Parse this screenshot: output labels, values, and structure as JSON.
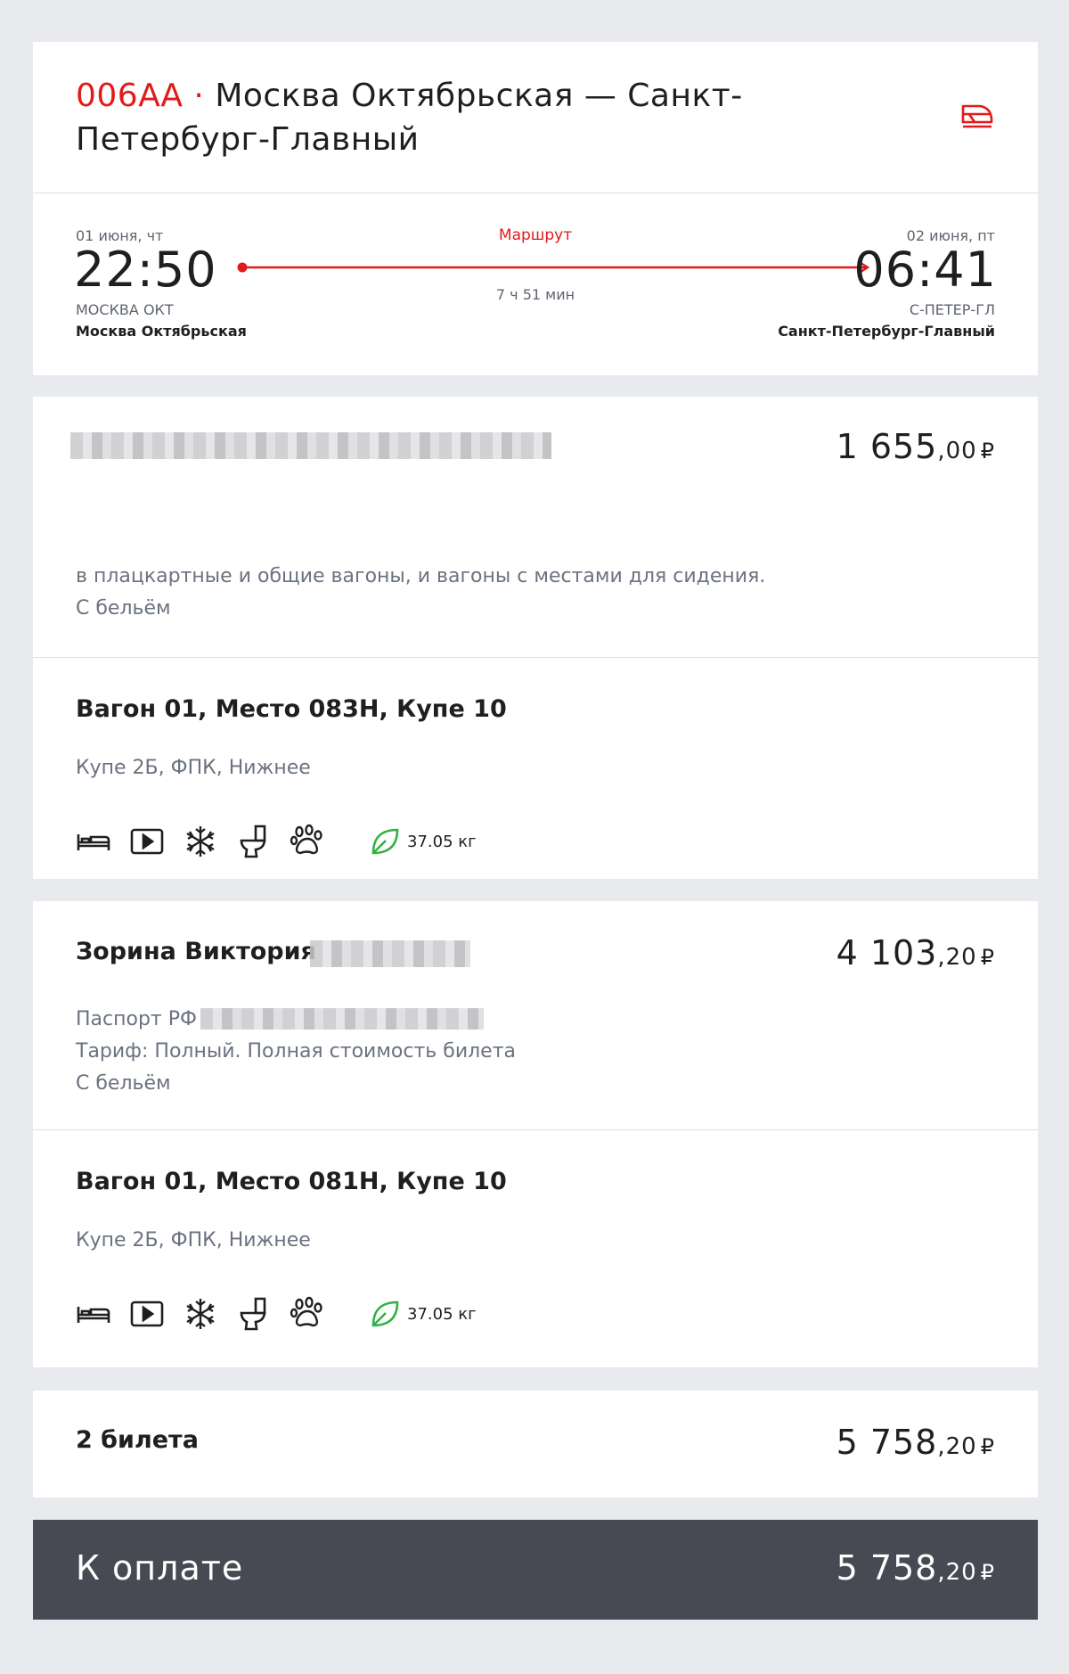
{
  "train": {
    "number": "006АА",
    "separator": "·",
    "route": "Москва Октябрьская — Санкт-Петербург-Главный",
    "brand_color": "#e21a1a",
    "logo_icon": "train-logo-icon"
  },
  "trip": {
    "departure": {
      "date": "01 июня, чт",
      "time": "22:50",
      "code": "МОСКВА ОКТ",
      "station": "Москва Октябрьская"
    },
    "route_label": "Маршрут",
    "duration": "7 ч 51 мин",
    "arrival": {
      "date": "02 июня, пт",
      "time": "06:41",
      "code": "С-ПЕТЕР-ГЛ",
      "station": "Санкт-Петербург-Главный"
    }
  },
  "passengers": [
    {
      "name": "",
      "price_main": "1 655",
      "price_cents": ",00",
      "currency": "₽",
      "info": [
        "в плацкартные и общие вагоны, и вагоны с местами для сидения.",
        "С бельём"
      ],
      "seat": "Вагон 01, Место 083Н, Купе 10",
      "car_type": "Купе 2Б, ФПК, Нижнее",
      "amenities": [
        "bed-icon",
        "video-icon",
        "snowflake-icon",
        "toilet-icon",
        "paw-icon"
      ],
      "eco": "37.05 кг"
    },
    {
      "name": "Зорина Виктория",
      "price_main": "4 103",
      "price_cents": ",20",
      "currency": "₽",
      "info": [
        "Паспорт РФ",
        "Тариф: Полный. Полная стоимость билета",
        "С бельём"
      ],
      "seat": "Вагон 01, Место 081Н, Купе 10",
      "car_type": "Купе 2Б, ФПК, Нижнее",
      "amenities": [
        "bed-icon",
        "video-icon",
        "snowflake-icon",
        "toilet-icon",
        "paw-icon"
      ],
      "eco": "37.05 кг"
    }
  ],
  "summary": {
    "tickets_label": "2 билета",
    "total_main": "5 758",
    "total_cents": ",20",
    "currency": "₽"
  },
  "payment": {
    "label": "К оплате",
    "amount_main": "5 758",
    "amount_cents": ",20",
    "currency": "₽",
    "bar_color": "#474a52"
  },
  "eco_color": "#2fb344"
}
